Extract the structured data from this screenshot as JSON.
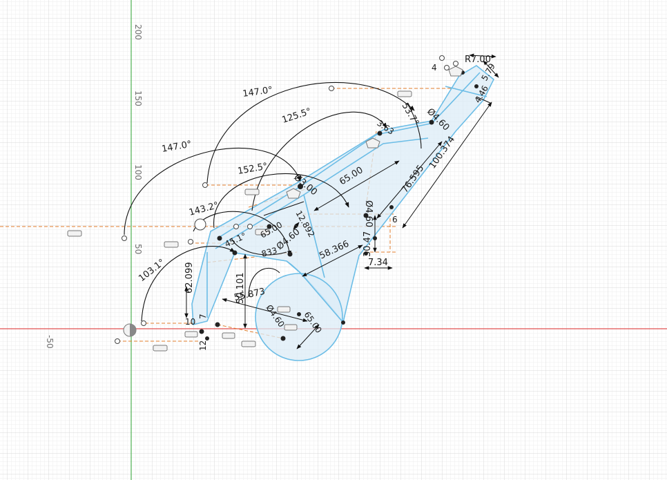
{
  "axis_labels": {
    "y200": "200",
    "y150": "150",
    "y100": "100",
    "y50": "50",
    "xm50": "-50"
  },
  "angles": {
    "a147_top": "147.0°",
    "a125": "125.5°",
    "a147_left": "147.0°",
    "a152": "152.5°",
    "a143": "143.2°",
    "a103": "103.1°",
    "a53": "53.7°",
    "a45": "45.1°"
  },
  "dimensions": {
    "r700": "R7.00",
    "d579": "5.79",
    "d4": "4",
    "d446": "4.46",
    "dia460_top": "Ø4.60",
    "d363": "3.63",
    "d65": "65.00",
    "d76": "76.595",
    "d100": "100.374",
    "dia_mid": "Ø3.00",
    "d65b": "65.00",
    "d12": "12.892",
    "dia460_mid": "Ø4.60",
    "d833": "833",
    "d58": "58.366",
    "d30": "30.47",
    "d734": "7.34",
    "d6": "6",
    "d50": "50.101",
    "d55": "55.873",
    "d62": "62.099",
    "d65c": "65.00",
    "dia460_low": "Ø4.60",
    "d7": "7",
    "d10": "10",
    "d12b": "12"
  },
  "colors": {
    "profile_fill": "#dcecf7",
    "profile_stroke": "#6cbde6",
    "construction": "#e07b2a",
    "grid_minor": "#ececec",
    "grid_major": "#d6d6d6",
    "y_axis": "#4caf50",
    "x_axis": "#e05050"
  }
}
